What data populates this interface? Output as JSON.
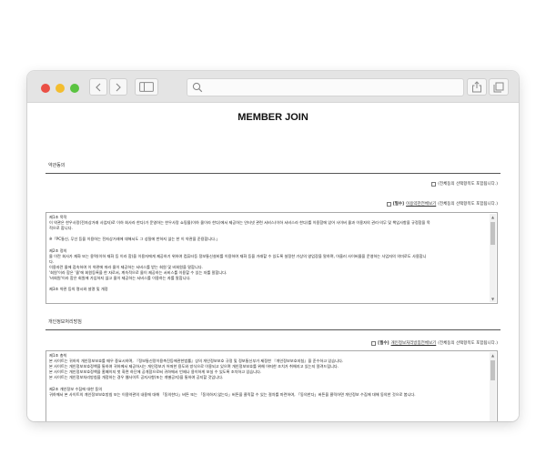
{
  "page": {
    "title": "MEMBER JOIN"
  },
  "agreement": {
    "section_label": "약관동의",
    "all_agree_text": "(전체동의 선택항목도 포함됩니다.)"
  },
  "terms": {
    "required_tag": "[필수]",
    "link_text": "이용약관전체보기",
    "agree_text": "(전체동의 선택항목도 포함됩니다.)",
    "lines": [
      "제1조 목적",
      "이 약관은 한우사랑(전자상거래 사업자)로 이하 회사라 한다)가 운영하는 한우사랑 쇼핑몰(이하 몰이라 한다)에서 제공하는 인터넷 관련 서비스(이하 서비스라 한다)를 이용함에 있어 사이버 몰과 이용자의 권리·의무 및 책임사항을 규정함을 목",
      "적으로 합니다.",
      "",
      "※「PC통신, 무선 등을 이용하는 전자상거래에 대해서도 그 성질에 반하지 않는 한 이 약관을 준용합니다.」",
      "",
      "제2조 정의",
      "몰 이란 회사가 재화 또는 용역(이하 재화 등 이라 함)을 이용자에게 제공하기 위하여 컴퓨터등 정보통신설비를 이용하여 재화 등을 거래할 수 있도록 설정한 가상의 영업장을 말하며, 아울러 사이버몰을 운영하는 사업자의 의미로도 사용합니",
      "다.",
      "이용자란 몰에 접속하여 이 약관에 따라 몰이 제공하는 서비스를 받는 회원 및 비회원을 말합니다.",
      "'회원'이라 함은 '몰'에 회원등록을 한 자로서, 계속적으로 몰이 제공하는 서비스를 이용할 수 있는 자를 말합니다.",
      "'비회원'이라 함은 회원에 가입하지 않고 몰이 제공하는 서비스를 이용하는 자를 말합니다.",
      "",
      "제3조 약관 등의 명시와 설명 및 개정"
    ]
  },
  "privacy": {
    "section_label": "개인정보처리방침",
    "required_tag": "[필수]",
    "link_text": "개인정보처리방침전체보기",
    "agree_text": "(전체동의 선택항목도 포함됩니다.)",
    "lines": [
      "제1조 총칙",
      "본 사이트는 귀하의 개인정보보호를 매우 중요시하며, 『정보통신망이용촉진등에관한법률』상의 개인정보보호 규정 및 정보통신부가 제정한 『개인정보보호지침』을 준수하고 있습니다.",
      "본 사이트는 개인정보보호정책을 통하여 귀하께서 제공하시는 개인정보가 어떠한 용도와 방식으로 이용되고 있으며 개인정보보호를 위해 어떠한 조치가 취해지고 있는지 알려드립니다.",
      "본 사이트는 개인정보보호정책을 홈페이지 첫 화면 하단에 공개함으로써 귀하께서 언제나 용이하게 보실 수 있도록 조치하고 있습니다.",
      "본 사이트는 개인정보처리방침을 개정하는 경우 웹사이트 공지사항(또는 개별공지)을 통하여 공지할 것입니다.",
      "",
      "제2조 개인정보 수집에 대한 동의",
      "귀하께서 본 사이트의 개인정보보호방침 또는 이용약관의 내용에 대해 「동의한다」버튼 또는 「동의하지 않는다」버튼을 클릭할 수 있는 절차를 마련하여, 「동의한다」버튼을 클릭하면 개인정보 수집에 대해 동의한 것으로 봅니다."
    ]
  },
  "browser": {
    "back_icon": "chevron-left-icon",
    "forward_icon": "chevron-right-icon",
    "sidebar_icon": "sidebar-icon",
    "search_icon": "search-icon",
    "share_icon": "share-icon",
    "tabs_icon": "tabs-icon",
    "colors": {
      "close": "#ea4f45",
      "minimize": "#f3bd2f",
      "maximize": "#5ac341",
      "toolbar": "#e4e4e4"
    }
  }
}
